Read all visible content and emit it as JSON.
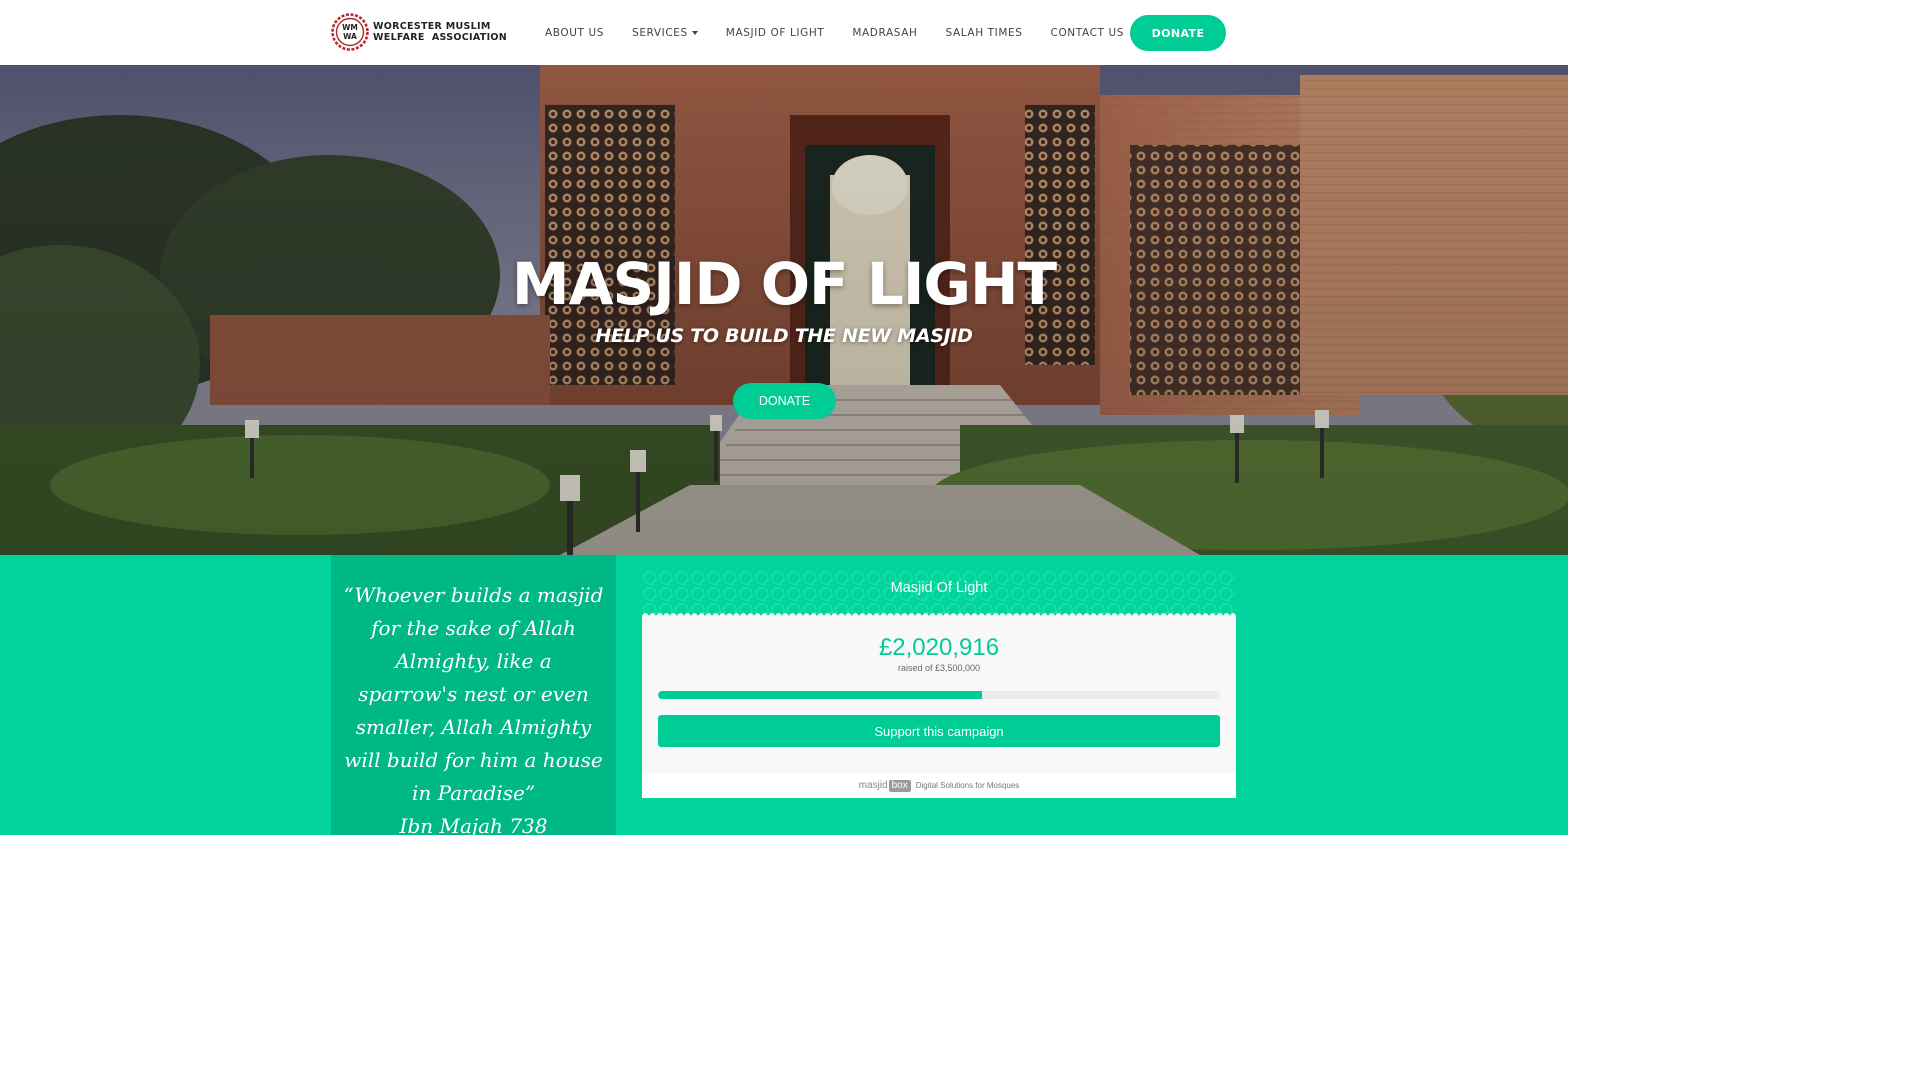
{
  "header": {
    "logo_line1": "WORCESTER MUSLIM",
    "logo_line2": "WELFARE  ASSOCIATION",
    "logo_mark_text": [
      "WM",
      "WA"
    ],
    "nav": [
      {
        "label": "ABOUT US",
        "has_dropdown": false
      },
      {
        "label": "SERVICES",
        "has_dropdown": true
      },
      {
        "label": "MASJID OF LIGHT",
        "has_dropdown": false
      },
      {
        "label": "MADRASAH",
        "has_dropdown": false
      },
      {
        "label": "SALAH TIMES",
        "has_dropdown": false
      },
      {
        "label": "CONTACT US",
        "has_dropdown": false
      }
    ],
    "donate_label": "DONATE"
  },
  "hero": {
    "title": "MASJID OF LIGHT",
    "subtitle": "HELP US TO BUILD THE NEW MASJID",
    "donate_label": "DONATE"
  },
  "quote": {
    "text": "“Whoever builds a masjid for the sake of Allah Almighty, like a sparrow's nest or even smaller, Allah Almighty will build for him a house in Paradise”",
    "reference": "Ibn Majah 738"
  },
  "campaign": {
    "title": "Masjid Of Light",
    "amount_raised": "£2,020,916",
    "raised_text": "raised of £3,500,000",
    "progress_fraction": 0.577,
    "button_label": "Support this campaign",
    "footer_brand_a": "masjid",
    "footer_brand_b": "box",
    "footer_tagline": "Digital Solutions for Mosques"
  },
  "colors": {
    "accent": "#00cc96",
    "band": "#00d49c",
    "quote_box": "#00b886"
  }
}
